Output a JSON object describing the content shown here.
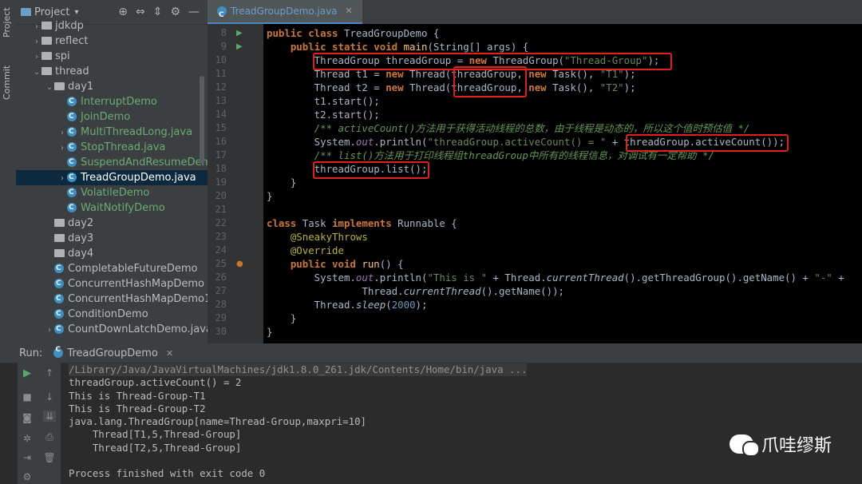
{
  "side_tabs": {
    "project": "Project",
    "commit": "Commit"
  },
  "project_panel": {
    "title": "Project",
    "tree": [
      {
        "label": "jdkdp",
        "kind": "folder",
        "indent": 1,
        "arrow": "›"
      },
      {
        "label": "reflect",
        "kind": "folder",
        "indent": 1,
        "arrow": "›"
      },
      {
        "label": "spi",
        "kind": "folder",
        "indent": 1,
        "arrow": "›"
      },
      {
        "label": "thread",
        "kind": "folder",
        "indent": 1,
        "arrow": "⌄"
      },
      {
        "label": "day1",
        "kind": "folder",
        "indent": 2,
        "arrow": "⌄"
      },
      {
        "label": "InterruptDemo",
        "kind": "class",
        "indent": 3,
        "arrow": "",
        "color": "#6aab73"
      },
      {
        "label": "JoinDemo",
        "kind": "class",
        "indent": 3,
        "arrow": "",
        "color": "#6aab73"
      },
      {
        "label": "MultiThreadLong.java",
        "kind": "class",
        "indent": 3,
        "arrow": "›",
        "color": "#6aab73"
      },
      {
        "label": "StopThread.java",
        "kind": "class",
        "indent": 3,
        "arrow": "›",
        "color": "#6aab73"
      },
      {
        "label": "SuspendAndResumeDemo",
        "kind": "class",
        "indent": 3,
        "arrow": "",
        "color": "#6aab73"
      },
      {
        "label": "TreadGroupDemo.java",
        "kind": "class",
        "indent": 3,
        "arrow": "›",
        "color": "#ffffff",
        "selected": true
      },
      {
        "label": "VolatileDemo",
        "kind": "class",
        "indent": 3,
        "arrow": "",
        "color": "#6aab73"
      },
      {
        "label": "WaitNotifyDemo",
        "kind": "class",
        "indent": 3,
        "arrow": "",
        "color": "#6aab73"
      },
      {
        "label": "day2",
        "kind": "folder",
        "indent": 2,
        "arrow": ""
      },
      {
        "label": "day3",
        "kind": "folder",
        "indent": 2,
        "arrow": ""
      },
      {
        "label": "day4",
        "kind": "folder",
        "indent": 2,
        "arrow": ""
      },
      {
        "label": "CompletableFutureDemo",
        "kind": "class",
        "indent": 2,
        "arrow": "",
        "color": "#bbbbbb"
      },
      {
        "label": "ConcurrentHashMapDemo",
        "kind": "class",
        "indent": 2,
        "arrow": "",
        "color": "#bbbbbb"
      },
      {
        "label": "ConcurrentHashMapDemo1",
        "kind": "class",
        "indent": 2,
        "arrow": "",
        "color": "#bbbbbb"
      },
      {
        "label": "ConditionDemo",
        "kind": "class",
        "indent": 2,
        "arrow": "",
        "color": "#bbbbbb"
      },
      {
        "label": "CountDownLatchDemo.java",
        "kind": "class",
        "indent": 2,
        "arrow": "›",
        "color": "#bbbbbb"
      }
    ]
  },
  "editor": {
    "tab": "TreadGroupDemo.java",
    "line_numbers": [
      "8",
      "9",
      "10",
      "11",
      "12",
      "13",
      "14",
      "15",
      "16",
      "17",
      "18",
      "19",
      "20",
      "21",
      "22",
      "23",
      "24",
      "25",
      "26",
      "27",
      "28",
      "29",
      "30"
    ]
  },
  "run_panel": {
    "label": "Run:",
    "tab": "TreadGroupDemo",
    "output": [
      "/Library/Java/JavaVirtualMachines/jdk1.8.0_261.jdk/Contents/Home/bin/java ...",
      "threadGroup.activeCount() = 2",
      "This is Thread-Group-T1",
      "This is Thread-Group-T2",
      "java.lang.ThreadGroup[name=Thread-Group,maxpri=10]",
      "    Thread[T1,5,Thread-Group]",
      "    Thread[T2,5,Thread-Group]",
      "",
      "Process finished with exit code 0"
    ]
  },
  "watermark": "爪哇缪斯"
}
